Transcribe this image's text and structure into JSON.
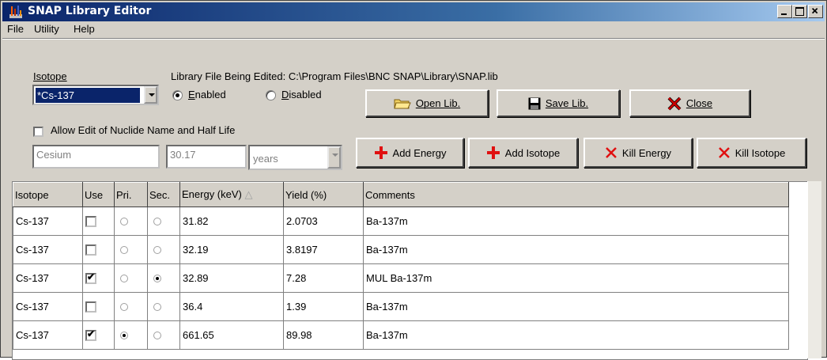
{
  "window": {
    "title": "SNAP Library Editor"
  },
  "menu": {
    "items": [
      "File",
      "Utility",
      "Help"
    ]
  },
  "isotope_section": {
    "label": "Isotope",
    "selected": "*Cs-137",
    "library_label": "Library File Being Edited: C:\\Program Files\\BNC SNAP\\Library\\SNAP.lib",
    "enabled_label": "Enabled",
    "disabled_label": "Disabled",
    "status": "Enabled"
  },
  "buttons": {
    "open": "Open Lib.",
    "save": "Save Lib.",
    "close": "Close",
    "add_energy": "Add Energy",
    "add_isotope": "Add Isotope",
    "kill_energy": "Kill Energy",
    "kill_isotope": "Kill Isotope"
  },
  "nuclide": {
    "allow_edit_label": "Allow Edit of Nuclide Name and Half Life",
    "allow_edit_checked": false,
    "name": "Cesium",
    "half_life": "30.17",
    "units": "years"
  },
  "table": {
    "columns": [
      "Isotope",
      "Use",
      "Pri.",
      "Sec.",
      "Energy (keV)",
      "Yield (%)",
      "Comments"
    ],
    "sort_indicator": "△",
    "rows": [
      {
        "isotope": "Cs-137",
        "use": false,
        "pri": false,
        "sec": false,
        "energy": "31.82",
        "yield": "2.0703",
        "comments": "Ba-137m"
      },
      {
        "isotope": "Cs-137",
        "use": false,
        "pri": false,
        "sec": false,
        "energy": "32.19",
        "yield": "3.8197",
        "comments": "Ba-137m"
      },
      {
        "isotope": "Cs-137",
        "use": true,
        "pri": false,
        "sec": true,
        "energy": "32.89",
        "yield": "7.28",
        "comments": "MUL Ba-137m"
      },
      {
        "isotope": "Cs-137",
        "use": false,
        "pri": false,
        "sec": false,
        "energy": "36.4",
        "yield": "1.39",
        "comments": "Ba-137m"
      },
      {
        "isotope": "Cs-137",
        "use": true,
        "pri": true,
        "sec": false,
        "energy": "661.65",
        "yield": "89.98",
        "comments": "Ba-137m"
      }
    ]
  },
  "colors": {
    "titlebar_start": "#0a246a",
    "titlebar_end": "#a6caf0",
    "face": "#d4d0c8",
    "selection": "#0a246a",
    "icon_red": "#e01010"
  }
}
